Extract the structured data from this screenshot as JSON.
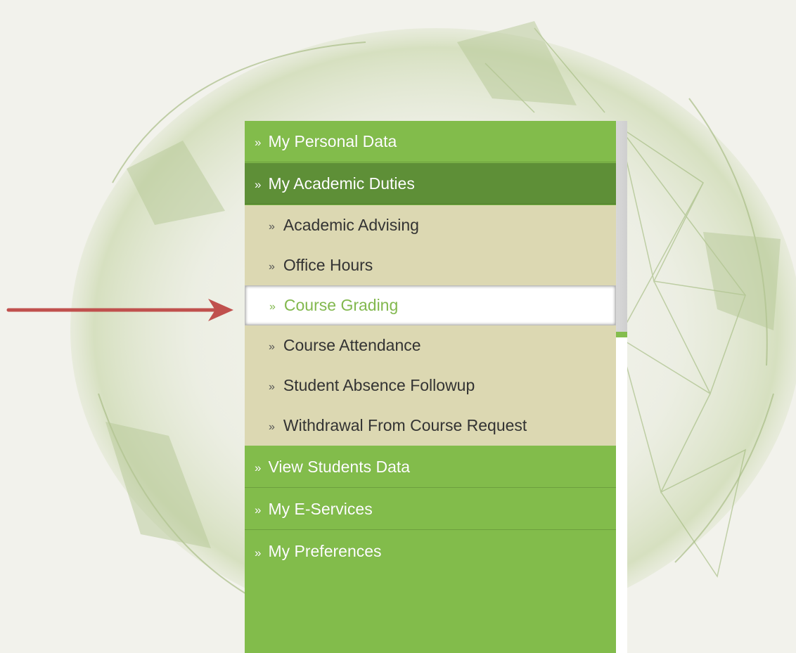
{
  "menu": {
    "arrow_glyph": "»",
    "top_items": [
      {
        "label": "My Personal Data"
      },
      {
        "label": "My Academic Duties",
        "active": true
      },
      {
        "label": "View Students Data"
      },
      {
        "label": "My E-Services"
      },
      {
        "label": "My Preferences"
      }
    ],
    "sub_items": [
      {
        "label": "Academic Advising"
      },
      {
        "label": "Office Hours"
      },
      {
        "label": "Course Grading",
        "selected": true
      },
      {
        "label": "Course Attendance"
      },
      {
        "label": "Student Absence Followup"
      },
      {
        "label": "Withdrawal From Course Request"
      }
    ]
  },
  "colors": {
    "menu_green": "#82bc4b",
    "active_green": "#5e8f37",
    "submenu_beige": "#dcd8b2",
    "selected_text_green": "#82b84e",
    "pointer_red": "#c0504d"
  },
  "annotation": {
    "pointer_icon": "red-right-arrow-icon"
  }
}
